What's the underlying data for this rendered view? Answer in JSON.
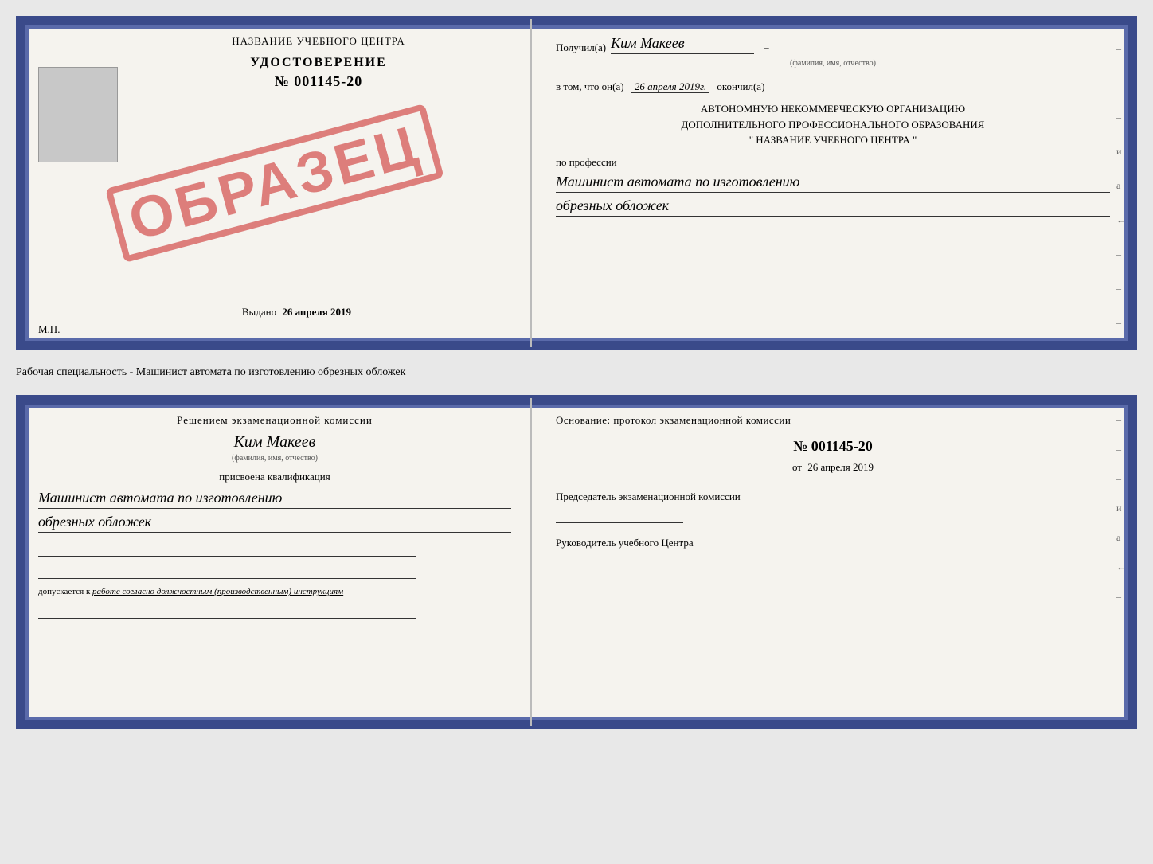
{
  "top_doc": {
    "left": {
      "title": "НАЗВАНИЕ УЧЕБНОГО ЦЕНТРА",
      "cert_label": "УДОСТОВЕРЕНИЕ",
      "cert_number": "№ 001145-20",
      "issued_prefix": "Выдано",
      "issued_date": "26 апреля 2019",
      "mp": "М.П.",
      "stamp": "ОБРАЗЕЦ"
    },
    "right": {
      "received_prefix": "Получил(а)",
      "received_name": "Ким Макеев",
      "name_sublabel": "(фамилия, имя, отчество)",
      "in_the_fact": "в том, что он(а)",
      "completion_date": "26 апреля 2019г.",
      "completed_label": "окончил(а)",
      "org_line1": "АВТОНОМНУЮ НЕКОММЕРЧЕСКУЮ ОРГАНИЗАЦИЮ",
      "org_line2": "ДОПОЛНИТЕЛЬНОГО ПРОФЕССИОНАЛЬНОГО ОБРАЗОВАНИЯ",
      "org_line3": "\"  НАЗВАНИЕ УЧЕБНОГО ЦЕНТРА  \"",
      "profession_label": "по профессии",
      "profession_line1": "Машинист автомата по изготовлению",
      "profession_line2": "обрезных обложек",
      "dashes": [
        "-",
        "-",
        "-",
        "и",
        "а",
        "←",
        "-",
        "-",
        "-",
        "-"
      ]
    }
  },
  "subtitle": "Рабочая специальность - Машинист автомата по изготовлению обрезных обложек",
  "bottom_doc": {
    "left": {
      "decision_label": "Решением экзаменационной комиссии",
      "person_name": "Ким Макеев",
      "name_sublabel": "(фамилия, имя, отчество)",
      "assigned_label": "присвоена квалификация",
      "qualification_line1": "Машинист автомата по изготовлению",
      "qualification_line2": "обрезных обложек",
      "allowed_prefix": "допускается к",
      "allowed_text": "работе согласно должностным (производственным) инструкциям"
    },
    "right": {
      "basis_label": "Основание: протокол экзаменационной комиссии",
      "protocol_number": "№ 001145-20",
      "protocol_date_prefix": "от",
      "protocol_date": "26 апреля 2019",
      "chairman_label": "Председатель экзаменационной комиссии",
      "director_label": "Руководитель учебного Центра",
      "dashes": [
        "-",
        "-",
        "-",
        "и",
        "а",
        "←",
        "-",
        "-"
      ]
    }
  }
}
